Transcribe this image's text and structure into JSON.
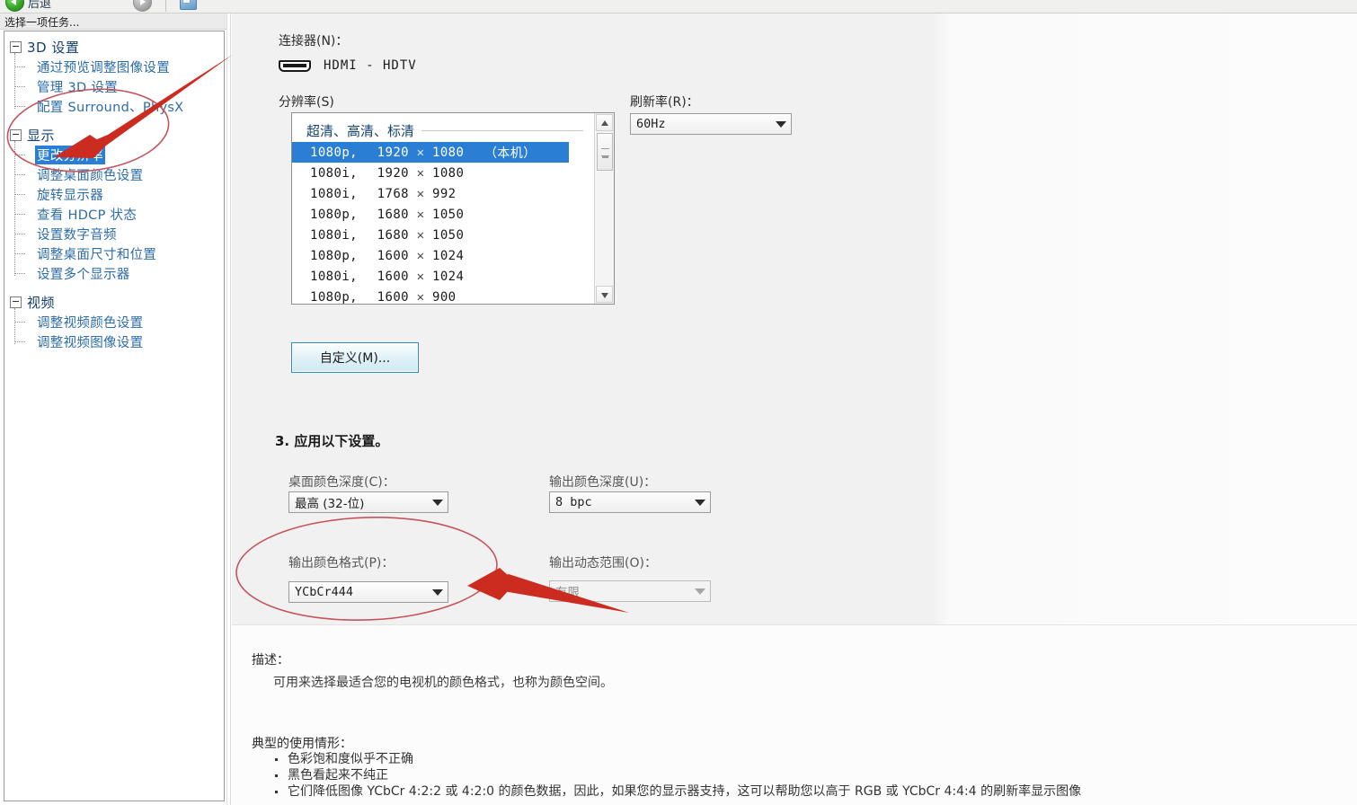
{
  "toolbar": {
    "back_label": "后退",
    "back_icon": "back-circle-icon",
    "forward_icon": "forward-circle-icon",
    "app_icon": "nvidia-panel-icon"
  },
  "sidebar": {
    "header": "选择一项任务...",
    "groups": [
      {
        "label": "3D 设置",
        "expander": "collapse-box-icon",
        "items": [
          {
            "label": "通过预览调整图像设置",
            "selected": false
          },
          {
            "label": "管理 3D 设置",
            "selected": false
          },
          {
            "label": "配置 Surround、PhysX",
            "selected": false
          }
        ]
      },
      {
        "label": "显示",
        "expander": "collapse-box-icon",
        "items": [
          {
            "label": "更改分辨率",
            "selected": true
          },
          {
            "label": "调整桌面颜色设置",
            "selected": false
          },
          {
            "label": "旋转显示器",
            "selected": false
          },
          {
            "label": "查看 HDCP 状态",
            "selected": false
          },
          {
            "label": "设置数字音频",
            "selected": false
          },
          {
            "label": "调整桌面尺寸和位置",
            "selected": false
          },
          {
            "label": "设置多个显示器",
            "selected": false
          }
        ]
      },
      {
        "label": "视频",
        "expander": "collapse-box-icon",
        "items": [
          {
            "label": "调整视频颜色设置",
            "selected": false
          },
          {
            "label": "调整视频图像设置",
            "selected": false
          }
        ]
      }
    ]
  },
  "main": {
    "connector": {
      "label": "连接器(N)：",
      "icon": "hdmi-port-icon",
      "value": "HDMI - HDTV"
    },
    "resolution": {
      "label": "分辨率(S)",
      "group_title": "超清、高清、标清",
      "rows": [
        {
          "mode": "1080p,",
          "w": "1920",
          "x": "✕",
          "h": "1080",
          "native": "（本机）",
          "selected": true
        },
        {
          "mode": "1080i,",
          "w": "1920",
          "x": "✕",
          "h": "1080",
          "native": "",
          "selected": false
        },
        {
          "mode": "1080i,",
          "w": "1768",
          "x": "✕",
          "h": "992",
          "native": "",
          "selected": false
        },
        {
          "mode": "1080p,",
          "w": "1680",
          "x": "✕",
          "h": "1050",
          "native": "",
          "selected": false
        },
        {
          "mode": "1080i,",
          "w": "1680",
          "x": "✕",
          "h": "1050",
          "native": "",
          "selected": false
        },
        {
          "mode": "1080p,",
          "w": "1600",
          "x": "✕",
          "h": "1024",
          "native": "",
          "selected": false
        },
        {
          "mode": "1080i,",
          "w": "1600",
          "x": "✕",
          "h": "1024",
          "native": "",
          "selected": false
        },
        {
          "mode": "1080p,",
          "w": "1600",
          "x": "✕",
          "h": "900",
          "native": "",
          "selected": false
        }
      ],
      "scrollbar": {
        "up_icon": "scroll-up-arrow-icon",
        "down_icon": "scroll-down-arrow-icon",
        "thumb_icon": "scroll-thumb-grip-icon"
      }
    },
    "refresh_rate": {
      "label": "刷新率(R)：",
      "value": "60Hz",
      "arrow_icon": "chevron-down-icon"
    },
    "custom_button": "自定义(M)...",
    "step3_title": "3.  应用以下设置。",
    "desktop_color_depth": {
      "label": "桌面颜色深度(C)：",
      "value": "最高 (32-位)",
      "arrow_icon": "chevron-down-icon"
    },
    "output_color_depth": {
      "label": "输出颜色深度(U)：",
      "value": "8 bpc",
      "arrow_icon": "chevron-down-icon"
    },
    "output_color_format": {
      "label": "输出颜色格式(P)：",
      "value": "YCbCr444",
      "arrow_icon": "chevron-down-icon"
    },
    "output_dynamic_range": {
      "label": "输出动态范围(O)：",
      "value": "有限",
      "arrow_icon": "chevron-down-icon"
    },
    "description": {
      "title": "描述：",
      "body": "可用来选择最适合您的电视机的颜色格式，也称为颜色空间。",
      "usage_title": "典型的使用情形：",
      "bullets": [
        "色彩饱和度似乎不正确",
        "黑色看起来不纯正",
        "它们降低图像 YCbCr 4:2:2 或 4:2:0 的颜色数据，因此，如果您的显示器支持，这可以帮助您以高于 RGB 或 YCbCr 4:4:4 的刷新率显示图像"
      ]
    }
  },
  "annotations": {
    "accent_color": "#cc2b20",
    "ellipse_color": "#c4545a",
    "ellipse_sidebar": "highlight-ellipse-change-resolution",
    "arrow_sidebar": "pointer-arrow-to-change-resolution",
    "ellipse_color_format": "highlight-ellipse-output-color-format",
    "arrow_color_format": "pointer-arrow-to-output-color-format"
  }
}
